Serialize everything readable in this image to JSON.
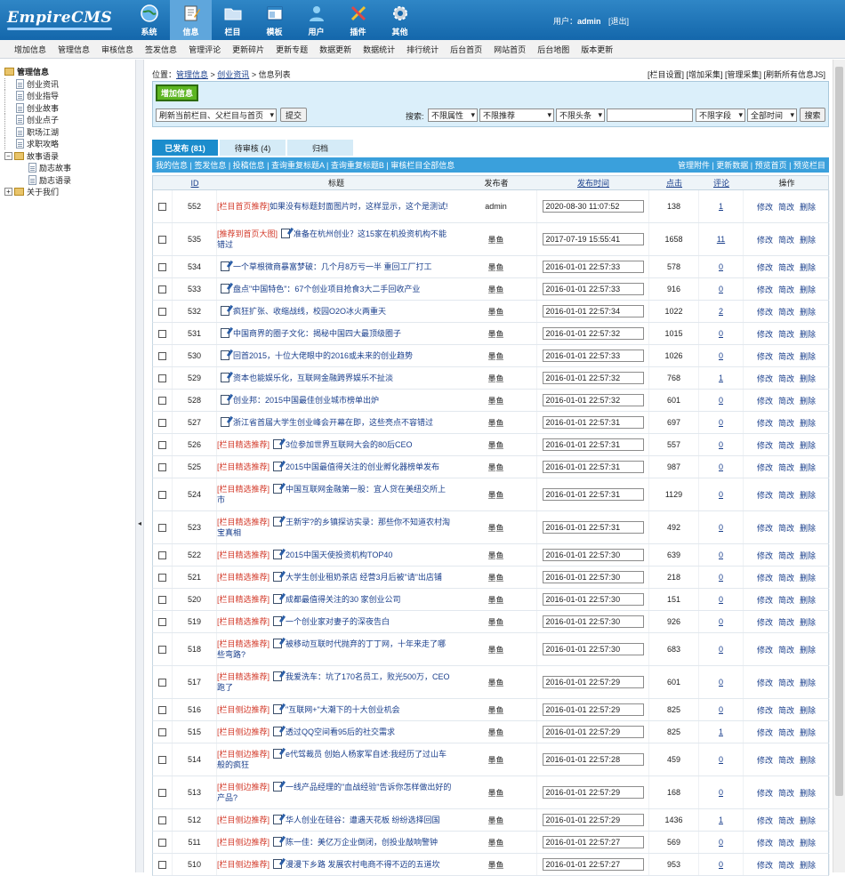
{
  "app": {
    "logo": "EmpireCMS"
  },
  "nav": [
    {
      "label": "系统",
      "icon": "globe-icon"
    },
    {
      "label": "信息",
      "icon": "document-edit-icon"
    },
    {
      "label": "栏目",
      "icon": "folder-icon"
    },
    {
      "label": "模板",
      "icon": "template-window-icon"
    },
    {
      "label": "用户",
      "icon": "user-icon"
    },
    {
      "label": "插件",
      "icon": "tools-icon"
    },
    {
      "label": "其他",
      "icon": "gear-icon"
    }
  ],
  "user": {
    "prefix": "用户：",
    "name": "admin",
    "logout": "[退出]"
  },
  "subnav": [
    "增加信息",
    "管理信息",
    "审核信息",
    "签发信息",
    "管理评论",
    "更新碎片",
    "更新专题",
    "数据更新",
    "数据统计",
    "排行统计",
    "后台首页",
    "网站首页",
    "后台地图",
    "版本更新"
  ],
  "tree": {
    "root": "管理信息",
    "items": [
      "创业资讯",
      "创业指导",
      "创业故事",
      "创业点子",
      "职场江湖",
      "求职攻略"
    ],
    "folder": "故事语录",
    "subitems": [
      "励志故事",
      "励志语录"
    ],
    "last": "关于我们"
  },
  "breadcrumb": {
    "prefix": "位置：",
    "a": "管理信息",
    "sep": " > ",
    "b": "创业资讯",
    "c": "信息列表"
  },
  "toplinks": "[栏目设置] [增加采集] [管理采集] [刷新所有信息JS]",
  "toolbar": {
    "add_label": "增加信息",
    "refresh_select": "刷新当前栏目、父栏目与首页",
    "submit": "提交",
    "search_label": "搜索:",
    "attr_select": "不限属性",
    "recommend_select": "不限推荐",
    "headline_select": "不限头条",
    "field_select": "不限字段",
    "time_select": "全部时间",
    "search_button": "搜索"
  },
  "tabs": [
    "已发布 (81)",
    "待审核 (4)",
    "归档"
  ],
  "bluebar": {
    "left": "我的信息 | 签发信息 | 投稿信息 | 查询重复标题A | 查询重复标题B | 审核栏目全部信息",
    "right": "管理附件 | 更新数据 | 预览首页 | 预览栏目"
  },
  "columns": {
    "id": "ID",
    "title": "标题",
    "publisher": "发布者",
    "time": "发布时间",
    "clicks": "点击",
    "comments": "评论",
    "ops": "操作"
  },
  "ops": [
    "修改",
    "简改",
    "删除"
  ],
  "rows": [
    {
      "id": "552",
      "tag": "[栏目首页推荐]",
      "icon": false,
      "title": "如果没有标题封面图片时，这样显示，这个是测试!",
      "pub": "admin",
      "time": "2020-08-30 11:07:52",
      "clicks": "138",
      "comments": "1",
      "h": 2
    },
    {
      "id": "535",
      "tag": "[推荐到首页大图]",
      "icon": true,
      "title": "准备在杭州创业？这15家在机投资机构不能错过",
      "pub": "墨鱼",
      "time": "2017-07-19 15:55:41",
      "clicks": "1658",
      "comments": "11",
      "h": 2
    },
    {
      "id": "534",
      "tag": "",
      "icon": true,
      "title": "一个草根微商暴富梦破：几个月8万亏一半 重回工厂打工",
      "pub": "墨鱼",
      "time": "2016-01-01 22:57:33",
      "clicks": "578",
      "comments": "0",
      "h": 1
    },
    {
      "id": "533",
      "tag": "",
      "icon": true,
      "title": "盘点\"中国特色\"：67个创业项目抢食3大二手回收产业",
      "pub": "墨鱼",
      "time": "2016-01-01 22:57:33",
      "clicks": "916",
      "comments": "0",
      "h": 1
    },
    {
      "id": "532",
      "tag": "",
      "icon": true,
      "title": "疯狂扩张、收缩战线，校园O2O冰火两重天",
      "pub": "墨鱼",
      "time": "2016-01-01 22:57:34",
      "clicks": "1022",
      "comments": "2",
      "h": 1
    },
    {
      "id": "531",
      "tag": "",
      "icon": true,
      "title": "中国商界的圈子文化：揭秘中国四大最顶级圈子",
      "pub": "墨鱼",
      "time": "2016-01-01 22:57:32",
      "clicks": "1015",
      "comments": "0",
      "h": 1
    },
    {
      "id": "530",
      "tag": "",
      "icon": true,
      "title": "回首2015，十位大佬眼中的2016或未来的创业趋势",
      "pub": "墨鱼",
      "time": "2016-01-01 22:57:33",
      "clicks": "1026",
      "comments": "0",
      "h": 1
    },
    {
      "id": "529",
      "tag": "",
      "icon": true,
      "title": "资本也能娱乐化，互联网金融跨界娱乐不扯淡",
      "pub": "墨鱼",
      "time": "2016-01-01 22:57:32",
      "clicks": "768",
      "comments": "1",
      "h": 1
    },
    {
      "id": "528",
      "tag": "",
      "icon": true,
      "title": "创业邦：2015中国最佳创业城市榜单出炉",
      "pub": "墨鱼",
      "time": "2016-01-01 22:57:32",
      "clicks": "601",
      "comments": "0",
      "h": 1
    },
    {
      "id": "527",
      "tag": "",
      "icon": true,
      "title": "浙江省首届大学生创业峰会开幕在即，这些亮点不容错过",
      "pub": "墨鱼",
      "time": "2016-01-01 22:57:31",
      "clicks": "697",
      "comments": "0",
      "h": 1
    },
    {
      "id": "526",
      "tag": "[栏目精选推荐]",
      "icon": true,
      "title": "3位参加世界互联网大会的80后CEO",
      "pub": "墨鱼",
      "time": "2016-01-01 22:57:31",
      "clicks": "557",
      "comments": "0",
      "h": 1
    },
    {
      "id": "525",
      "tag": "[栏目精选推荐]",
      "icon": true,
      "title": "2015中国最值得关注的创业孵化器榜单发布",
      "pub": "墨鱼",
      "time": "2016-01-01 22:57:31",
      "clicks": "987",
      "comments": "0",
      "h": 1
    },
    {
      "id": "524",
      "tag": "[栏目精选推荐]",
      "icon": true,
      "title": "中国互联网金融第一股：宜人贷在美纽交所上市",
      "pub": "墨鱼",
      "time": "2016-01-01 22:57:31",
      "clicks": "1129",
      "comments": "0",
      "h": 2
    },
    {
      "id": "523",
      "tag": "[栏目精选推荐]",
      "icon": true,
      "title": "王新宇?的乡镇探访实录：那些你不知道农村淘宝真相",
      "pub": "墨鱼",
      "time": "2016-01-01 22:57:31",
      "clicks": "492",
      "comments": "0",
      "h": 2
    },
    {
      "id": "522",
      "tag": "[栏目精选推荐]",
      "icon": true,
      "title": "2015中国天使投资机构TOP40",
      "pub": "墨鱼",
      "time": "2016-01-01 22:57:30",
      "clicks": "639",
      "comments": "0",
      "h": 1
    },
    {
      "id": "521",
      "tag": "[栏目精选推荐]",
      "icon": true,
      "title": "大学生创业租奶茶店 经营3月后被\"请\"出店铺",
      "pub": "墨鱼",
      "time": "2016-01-01 22:57:30",
      "clicks": "218",
      "comments": "0",
      "h": 1
    },
    {
      "id": "520",
      "tag": "[栏目精选推荐]",
      "icon": true,
      "title": "成都最值得关注的30 家创业公司",
      "pub": "墨鱼",
      "time": "2016-01-01 22:57:30",
      "clicks": "151",
      "comments": "0",
      "h": 1
    },
    {
      "id": "519",
      "tag": "[栏目精选推荐]",
      "icon": true,
      "title": "一个创业家对妻子的深夜告白",
      "pub": "墨鱼",
      "time": "2016-01-01 22:57:30",
      "clicks": "926",
      "comments": "0",
      "h": 1
    },
    {
      "id": "518",
      "tag": "[栏目精选推荐]",
      "icon": true,
      "title": "被移动互联时代抛弃的丁丁网，十年来走了哪些弯路?",
      "pub": "墨鱼",
      "time": "2016-01-01 22:57:30",
      "clicks": "683",
      "comments": "0",
      "h": 2
    },
    {
      "id": "517",
      "tag": "[栏目精选推荐]",
      "icon": true,
      "title": "我爱洗车：坑了170名员工，败光500万，CEO跑了",
      "pub": "墨鱼",
      "time": "2016-01-01 22:57:29",
      "clicks": "601",
      "comments": "0",
      "h": 2
    },
    {
      "id": "516",
      "tag": "[栏目侧边推荐]",
      "icon": true,
      "title": "\"互联网+\"大潮下的十大创业机会",
      "pub": "墨鱼",
      "time": "2016-01-01 22:57:29",
      "clicks": "825",
      "comments": "0",
      "h": 1
    },
    {
      "id": "515",
      "tag": "[栏目侧边推荐]",
      "icon": true,
      "title": "透过QQ空间看95后的社交需求",
      "pub": "墨鱼",
      "time": "2016-01-01 22:57:29",
      "clicks": "825",
      "comments": "1",
      "h": 1
    },
    {
      "id": "514",
      "tag": "[栏目侧边推荐]",
      "icon": true,
      "title": "e代驾裁员 创始人杨家军自述:我经历了过山车般的疯狂",
      "pub": "墨鱼",
      "time": "2016-01-01 22:57:28",
      "clicks": "459",
      "comments": "0",
      "h": 2
    },
    {
      "id": "513",
      "tag": "[栏目侧边推荐]",
      "icon": true,
      "title": "一线产品经理的\"血战经验\"告诉你怎样做出好的产品?",
      "pub": "墨鱼",
      "time": "2016-01-01 22:57:29",
      "clicks": "168",
      "comments": "0",
      "h": 2
    },
    {
      "id": "512",
      "tag": "[栏目侧边推荐]",
      "icon": true,
      "title": "华人创业在硅谷：遭遇天花板 纷纷选择回国",
      "pub": "墨鱼",
      "time": "2016-01-01 22:57:29",
      "clicks": "1436",
      "comments": "1",
      "h": 1
    },
    {
      "id": "511",
      "tag": "[栏目侧边推荐]",
      "icon": true,
      "title": "陈一佳：美亿万企业倒闭，创投业敲响警钟",
      "pub": "墨鱼",
      "time": "2016-01-01 22:57:27",
      "clicks": "569",
      "comments": "0",
      "h": 1
    },
    {
      "id": "510",
      "tag": "[栏目侧边推荐]",
      "icon": true,
      "title": "漫漫下乡路 发展农村电商不得不迈的五道坎",
      "pub": "墨鱼",
      "time": "2016-01-01 22:57:27",
      "clicks": "953",
      "comments": "0",
      "h": 1
    }
  ]
}
